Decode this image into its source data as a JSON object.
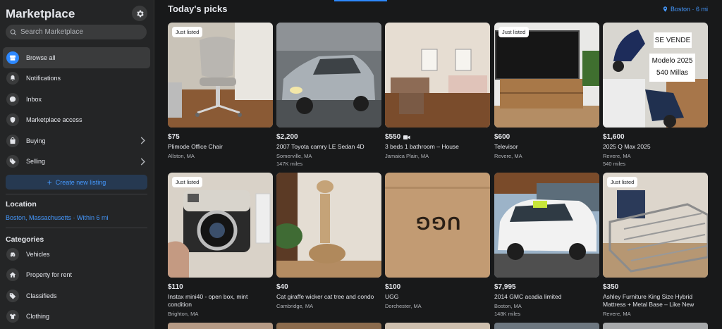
{
  "sidebar": {
    "title": "Marketplace",
    "search_placeholder": "Search Marketplace",
    "nav": [
      {
        "label": "Browse all",
        "icon": "storefront-icon",
        "active": true
      },
      {
        "label": "Notifications",
        "icon": "bell-icon"
      },
      {
        "label": "Inbox",
        "icon": "messenger-icon"
      },
      {
        "label": "Marketplace access",
        "icon": "shield-icon"
      },
      {
        "label": "Buying",
        "icon": "bag-icon",
        "chevron": true
      },
      {
        "label": "Selling",
        "icon": "tag-icon",
        "chevron": true
      }
    ],
    "create_listing": "Create new listing",
    "location_title": "Location",
    "location_value": "Boston, Massachusetts · Within 6 mi",
    "categories_title": "Categories",
    "categories": [
      {
        "label": "Vehicles",
        "icon": "car-icon"
      },
      {
        "label": "Property for rent",
        "icon": "house-icon"
      },
      {
        "label": "Classifieds",
        "icon": "tag-icon"
      },
      {
        "label": "Clothing",
        "icon": "shirt-icon"
      }
    ]
  },
  "main": {
    "title": "Today's picks",
    "location_link": "Boston · 6 mi",
    "listings": [
      {
        "price": "$75",
        "title": "Plimode Office Chair",
        "location": "Allston, MA",
        "badge": "Just listed"
      },
      {
        "price": "$2,200",
        "title": "2007 Toyota camry LE Sedan 4D",
        "location": "Somerville, MA",
        "miles": "147K miles"
      },
      {
        "price": "$550",
        "title": "3 beds 1 bathroom – House",
        "location": "Jamaica Plain, MA",
        "video": true
      },
      {
        "price": "$600",
        "title": "Televisor",
        "location": "Revere, MA",
        "badge": "Just listed"
      },
      {
        "price": "$1,600",
        "title": "2025 Q Max 2025",
        "location": "Revere, MA",
        "miles": "540 miles",
        "overlay": [
          "SE VENDE",
          "Modelo 2025",
          "540 Millas"
        ]
      },
      {
        "price": "$110",
        "title": "Instax mini40 - open box, mint condition",
        "location": "Brighton, MA",
        "badge": "Just listed"
      },
      {
        "price": "$40",
        "title": "Cat giraffe wicker cat tree and condo",
        "location": "Cambridge, MA"
      },
      {
        "price": "$100",
        "title": "UGG",
        "location": "Dorchester, MA",
        "overlay": [
          "UGG"
        ]
      },
      {
        "price": "$7,995",
        "title": "2014 GMC acadia limited",
        "location": "Boston, MA",
        "miles": "148K miles"
      },
      {
        "price": "$350",
        "title": "Ashley Furniture King Size Hybrid Mattress + Metal Base – Like New",
        "location": "Revere, MA",
        "badge": "Just listed"
      }
    ]
  },
  "colors": {
    "background": "#18191a",
    "sidebar": "#242526",
    "accent": "#2d88ff",
    "link": "#4599ff"
  }
}
